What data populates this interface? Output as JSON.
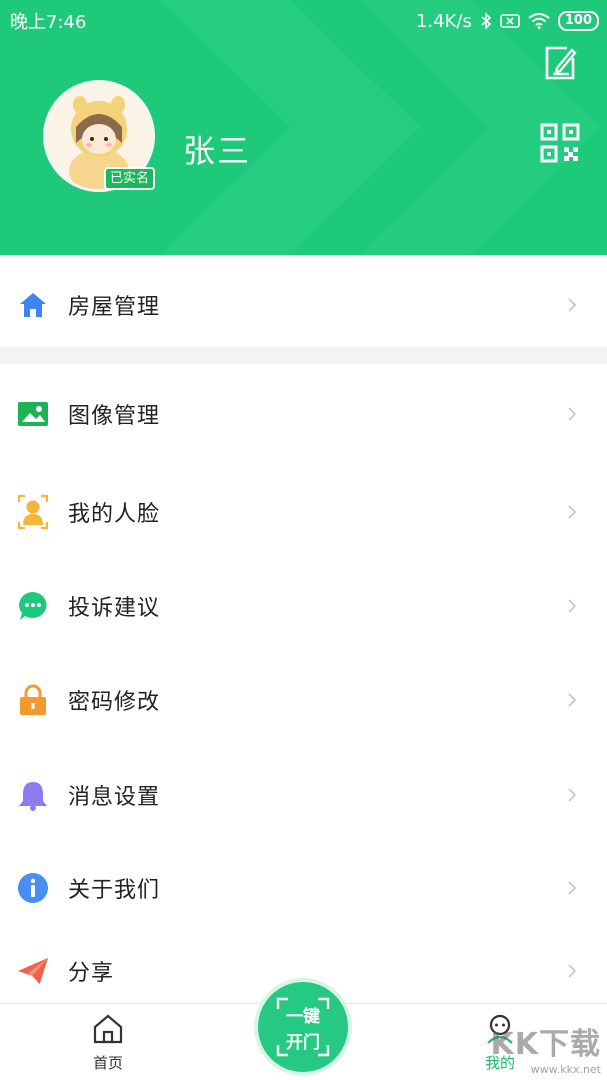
{
  "status_bar": {
    "time": "晚上7:46",
    "network_speed": "1.4K/s",
    "battery": "100"
  },
  "profile": {
    "name": "张三",
    "verified_badge": "已实名",
    "avatar_icon": "cartoon-avatar-icon"
  },
  "header_actions": {
    "edit_icon": "edit-icon",
    "qr_icon": "qr-code-icon"
  },
  "menu": {
    "items": [
      {
        "label": "房屋管理",
        "icon": "home-icon",
        "color": "#3b86f0"
      },
      {
        "label": "图像管理",
        "icon": "image-icon",
        "color": "#1fb155"
      },
      {
        "label": "我的人脸",
        "icon": "face-icon",
        "color": "#f5b53a"
      },
      {
        "label": "投诉建议",
        "icon": "chat-bubble-icon",
        "color": "#1fc97a"
      },
      {
        "label": "密码修改",
        "icon": "lock-icon",
        "color": "#f29a2e"
      },
      {
        "label": "消息设置",
        "icon": "bell-icon",
        "color": "#8b7cf0"
      },
      {
        "label": "关于我们",
        "icon": "info-icon",
        "color": "#4a8ef0"
      },
      {
        "label": "分享",
        "icon": "paper-plane-icon",
        "color": "#f0604a"
      }
    ]
  },
  "bottom_nav": {
    "home_label": "首页",
    "open_door_line1": "一键",
    "open_door_line2": "开门",
    "mine_label": "我的",
    "active_color": "#1fb86e"
  },
  "watermark": {
    "text": "KK下载",
    "url": "www.kkx.net"
  }
}
